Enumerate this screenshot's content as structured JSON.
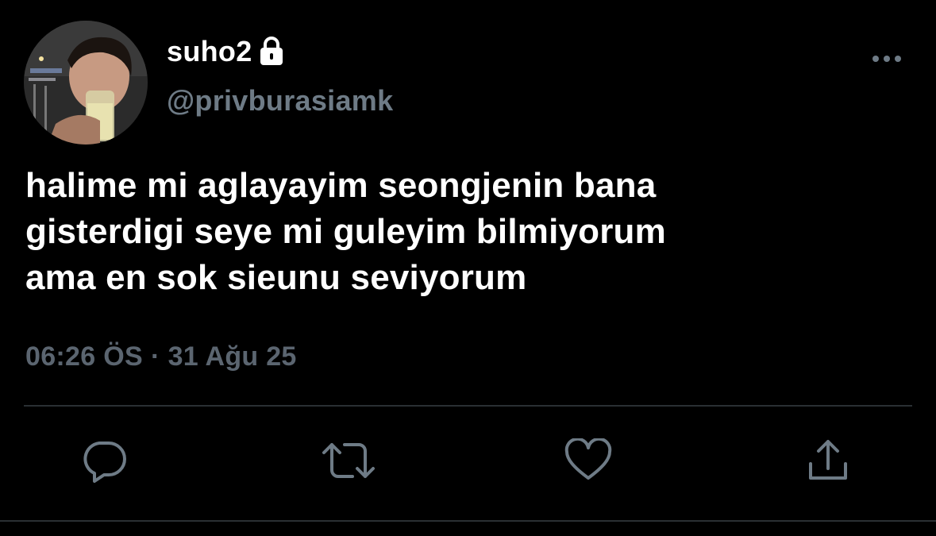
{
  "user": {
    "display_name": "suho2",
    "handle": "@privburasiamk",
    "protected_icon": "lock-icon",
    "avatar": "profile-photo"
  },
  "tweet": {
    "lines": [
      "halime mi aglayayim seongjenin bana",
      "gisterdigi seye mi guleyim bilmiyorum",
      "ama en sok sieunu seviyorum"
    ],
    "time": "06:26 ÖS",
    "separator": "·",
    "date": "31 Ağu 25"
  },
  "icons": {
    "more": "more-options-icon",
    "reply": "reply-icon",
    "retweet": "retweet-icon",
    "like": "heart-icon",
    "share": "share-icon"
  },
  "colors": {
    "background": "#000000",
    "primary_text": "#ffffff",
    "secondary_text": "#6e7b86",
    "meta_text": "#5b6570",
    "icon": "#6e7b86",
    "divider": "#2a2f33"
  }
}
